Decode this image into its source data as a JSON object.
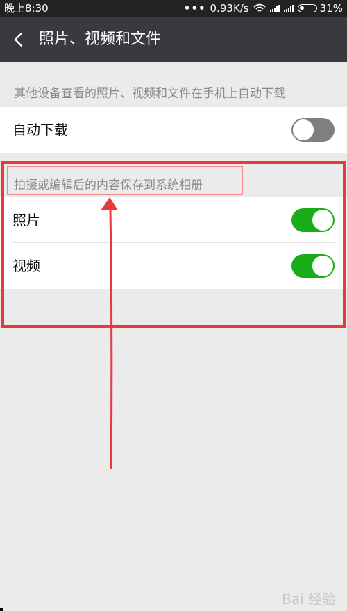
{
  "status_bar": {
    "time": "晚上8:30",
    "dots": "•••",
    "network_speed": "0.93K/s",
    "battery_percent": "31%",
    "icons": [
      "wifi-icon",
      "signal-icon",
      "signal-icon",
      "battery-icon"
    ]
  },
  "header": {
    "back_icon": "chevron-left-icon",
    "title": "照片、视频和文件"
  },
  "auto_download_section": {
    "description": "其他设备查看的照片、视频和文件在手机上自动下载",
    "rows": [
      {
        "label": "自动下载",
        "enabled": false
      }
    ]
  },
  "save_section": {
    "description": "拍摄或编辑后的内容保存到系统相册",
    "rows": [
      {
        "label": "照片",
        "enabled": true
      },
      {
        "label": "视频",
        "enabled": true
      }
    ]
  },
  "colors": {
    "title_bar": "#393a3f",
    "status_bar": "#232323",
    "background": "#ebebeb",
    "switch_on": "#1aad19",
    "switch_off": "#7f7f7f",
    "annotation": "#e8393f"
  },
  "watermark": "Bai 经验"
}
